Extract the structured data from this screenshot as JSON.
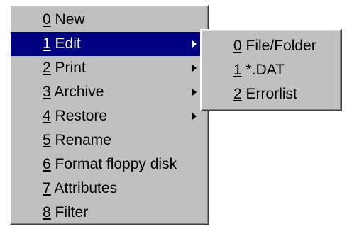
{
  "main_menu": {
    "items": [
      {
        "num": "0",
        "label": " New"
      },
      {
        "num": "1",
        "label": " Edit"
      },
      {
        "num": "2",
        "label": " Print"
      },
      {
        "num": "3",
        "label": " Archive"
      },
      {
        "num": "4",
        "label": " Restore"
      },
      {
        "num": "5",
        "label": " Rename"
      },
      {
        "num": "6",
        "label": " Format floppy disk"
      },
      {
        "num": "7",
        "label": " Attributes"
      },
      {
        "num": "8",
        "label": " Filter"
      }
    ]
  },
  "sub_menu": {
    "items": [
      {
        "num": "0",
        "label": " File/Folder"
      },
      {
        "num": "1",
        "label": " *.DAT"
      },
      {
        "num": "2",
        "label": " Errorlist"
      }
    ]
  },
  "colors": {
    "menu_bg": "#c0c0c0",
    "highlight": "#000080",
    "highlight_text": "#ffffff"
  },
  "icons": {
    "submenu_arrow": "arrow-right-icon"
  }
}
